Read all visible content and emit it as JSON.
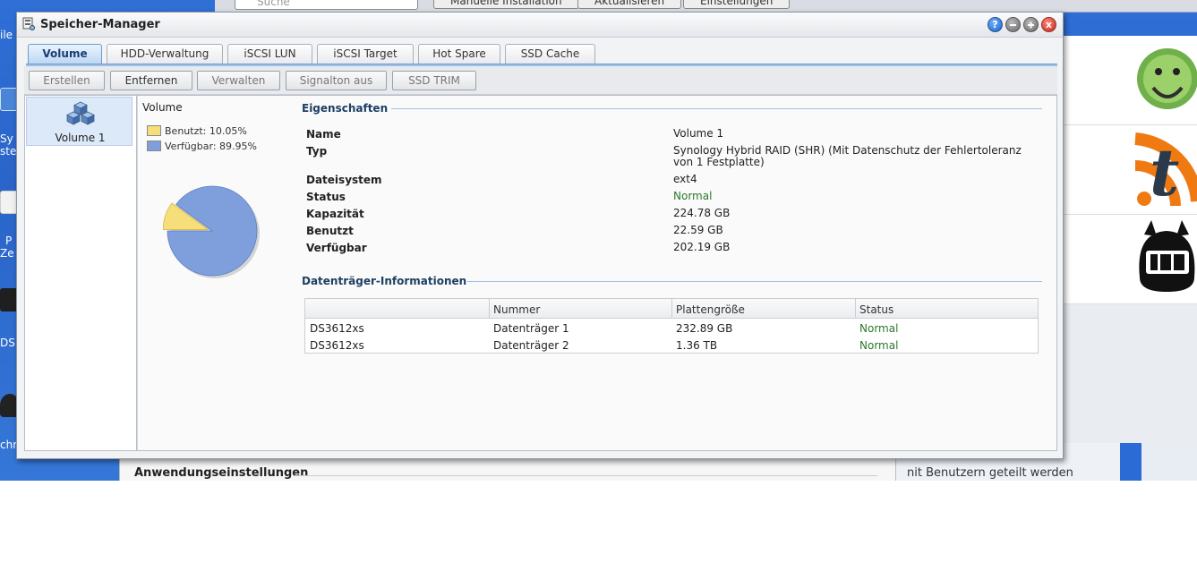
{
  "window": {
    "title": "Speicher-Manager",
    "buttons": {
      "help": "?",
      "close": "x"
    }
  },
  "tabs": [
    "Volume",
    "HDD-Verwaltung",
    "iSCSI LUN",
    "iSCSI Target",
    "Hot Spare",
    "SSD Cache"
  ],
  "active_tab": "Volume",
  "toolbar": {
    "create": "Erstellen",
    "remove": "Entfernen",
    "manage": "Verwalten",
    "signal_off": "Signalton aus",
    "ssd_trim": "SSD TRIM"
  },
  "volumes": [
    {
      "label": "Volume 1"
    }
  ],
  "chart_panel": {
    "title": "Volume",
    "legend_used": "Benutzt: 10.05%",
    "legend_free": "Verfügbar: 89.95%"
  },
  "chart_data": {
    "type": "pie",
    "title": "Volume",
    "categories": [
      "Benutzt",
      "Verfügbar"
    ],
    "values": [
      10.05,
      89.95
    ],
    "colors": [
      "#f6df7a",
      "#7f9fdc"
    ]
  },
  "properties": {
    "heading": "Eigenschaften",
    "rows": [
      {
        "label": "Name",
        "value": "Volume 1"
      },
      {
        "label": "Typ",
        "value": "Synology Hybrid RAID (SHR) (Mit Datenschutz der Fehlertoleranz von 1 Festplatte)"
      },
      {
        "label": "Dateisystem",
        "value": "ext4"
      },
      {
        "label": "Status",
        "value": "Normal"
      },
      {
        "label": "Kapazität",
        "value": "224.78 GB"
      },
      {
        "label": "Benutzt",
        "value": "22.59 GB"
      },
      {
        "label": "Verfügbar",
        "value": "202.19 GB"
      }
    ]
  },
  "disks": {
    "heading": "Datenträger-Informationen",
    "columns": [
      "",
      "Nummer",
      "Plattengröße",
      "Status"
    ],
    "rows": [
      [
        "DS3612xs",
        "Datenträger 1",
        "232.89 GB",
        "Normal"
      ],
      [
        "DS3612xs",
        "Datenträger 2",
        "1.36 TB",
        "Normal"
      ]
    ]
  },
  "background": {
    "search_placeholder": "Suche",
    "top_buttons": [
      "Manuelle Installation",
      "Aktualisieren",
      "Einstellungen"
    ],
    "section_title": "Anwendungseinstellungen",
    "right_text": "nit Benutzern geteilt werden",
    "desktop_labels": [
      "ile",
      "Sy",
      "ste",
      "P",
      "Ze",
      "DS",
      "chr"
    ]
  },
  "colors": {
    "status_ok": "#2a7a2a",
    "accent": "#9ec1e6",
    "desktop": "#2f6fd6"
  }
}
